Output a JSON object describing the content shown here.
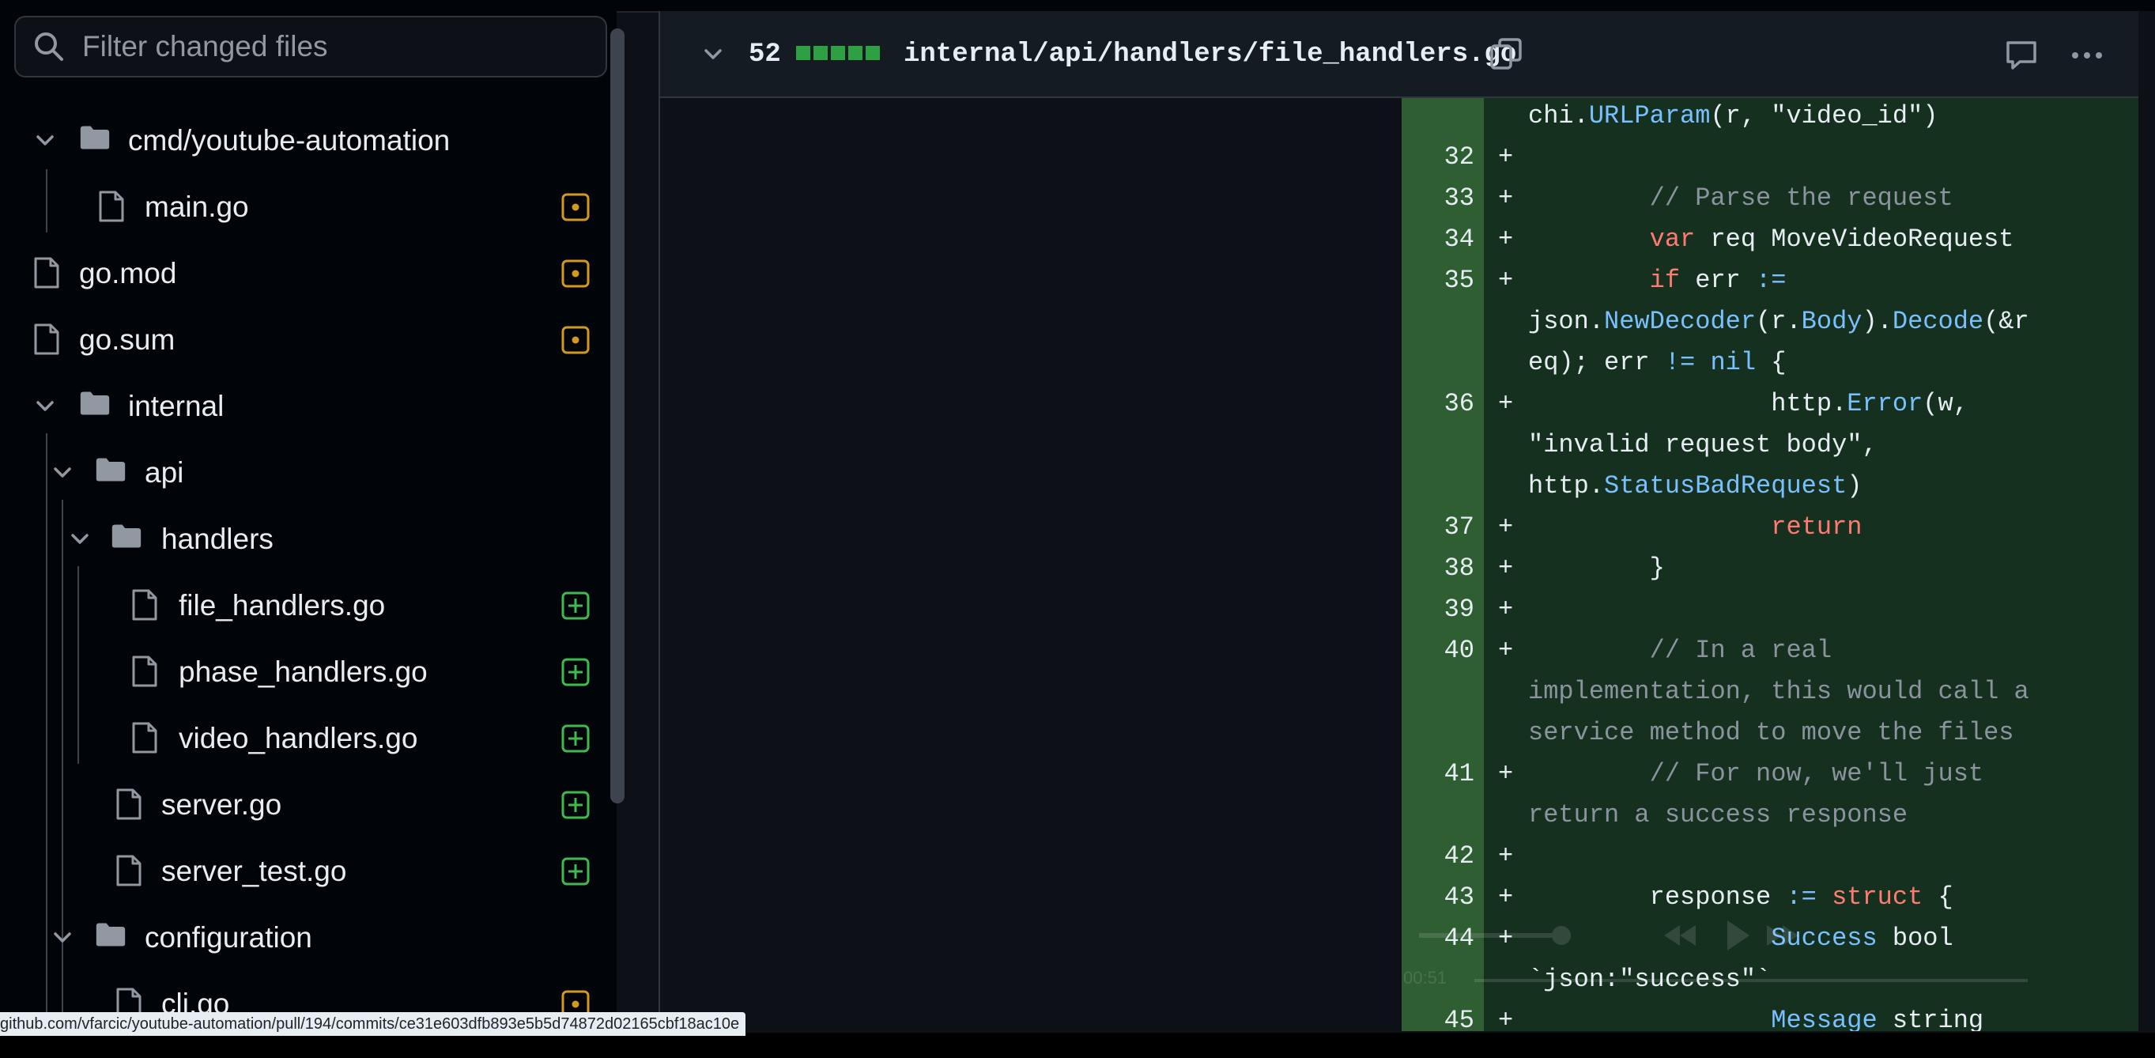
{
  "sidebar": {
    "filter_placeholder": "Filter changed files",
    "tree": [
      {
        "label": "cmd/youtube-automation",
        "type": "folder",
        "expanded": true
      },
      {
        "label": "main.go",
        "type": "file",
        "status": "modified"
      },
      {
        "label": "go.mod",
        "type": "file",
        "status": "modified"
      },
      {
        "label": "go.sum",
        "type": "file",
        "status": "modified"
      },
      {
        "label": "internal",
        "type": "folder",
        "expanded": true
      },
      {
        "label": "api",
        "type": "folder",
        "expanded": true
      },
      {
        "label": "handlers",
        "type": "folder",
        "expanded": true
      },
      {
        "label": "file_handlers.go",
        "type": "file",
        "status": "added"
      },
      {
        "label": "phase_handlers.go",
        "type": "file",
        "status": "added"
      },
      {
        "label": "video_handlers.go",
        "type": "file",
        "status": "added"
      },
      {
        "label": "server.go",
        "type": "file",
        "status": "added"
      },
      {
        "label": "server_test.go",
        "type": "file",
        "status": "added"
      },
      {
        "label": "configuration",
        "type": "folder",
        "expanded": true
      },
      {
        "label": "cli.go",
        "type": "file",
        "status": "modified"
      }
    ]
  },
  "diff": {
    "changes_count": "52",
    "file_path": "internal/api/handlers/file_handlers.go",
    "lines": [
      {
        "num": "",
        "plus": "",
        "text": "chi.URLParam(r, \"video_id\")"
      },
      {
        "num": "32",
        "plus": "+",
        "text": ""
      },
      {
        "num": "33",
        "plus": "+",
        "text": "        // Parse the request"
      },
      {
        "num": "34",
        "plus": "+",
        "text": "        var req MoveVideoRequest"
      },
      {
        "num": "35",
        "plus": "+",
        "text": "        if err :="
      },
      {
        "num": "",
        "plus": "",
        "text": "json.NewDecoder(r.Body).Decode(&r"
      },
      {
        "num": "",
        "plus": "",
        "text": "eq); err != nil {"
      },
      {
        "num": "36",
        "plus": "+",
        "text": "                http.Error(w,"
      },
      {
        "num": "",
        "plus": "",
        "text": "\"invalid request body\","
      },
      {
        "num": "",
        "plus": "",
        "text": "http.StatusBadRequest)"
      },
      {
        "num": "37",
        "plus": "+",
        "text": "                return"
      },
      {
        "num": "38",
        "plus": "+",
        "text": "        }"
      },
      {
        "num": "39",
        "plus": "+",
        "text": ""
      },
      {
        "num": "40",
        "plus": "+",
        "text": "        // In a real"
      },
      {
        "num": "",
        "plus": "",
        "text": "implementation, this would call a"
      },
      {
        "num": "",
        "plus": "",
        "text": "service method to move the files"
      },
      {
        "num": "41",
        "plus": "+",
        "text": "        // For now, we'll just"
      },
      {
        "num": "",
        "plus": "",
        "text": "return a success response"
      },
      {
        "num": "42",
        "plus": "+",
        "text": ""
      },
      {
        "num": "43",
        "plus": "+",
        "text": "        response := struct {"
      },
      {
        "num": "44",
        "plus": "+",
        "text": "                Success bool"
      },
      {
        "num": "",
        "plus": "",
        "text": "`json:\"success\"`"
      },
      {
        "num": "45",
        "plus": "+",
        "text": "                Message string"
      }
    ]
  },
  "status_url": "github.com/vfarcic/youtube-automation/pull/194/commits/ce31e603dfb893e5b5d74872d02165cbf18ac10e",
  "video_overlay": {
    "time": "00:51"
  },
  "colors": {
    "modified": "#d29922",
    "added": "#3fb950",
    "keyword": "#ff7b72",
    "function": "#79c0ff",
    "comment": "#8b949e"
  }
}
